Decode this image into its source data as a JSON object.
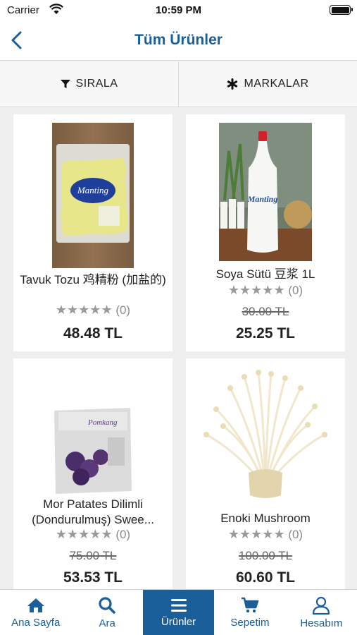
{
  "status_bar": {
    "carrier": "Carrier",
    "time": "10:59 PM"
  },
  "nav": {
    "title": "Tüm Ürünler",
    "back_icon": "chevron-left-icon"
  },
  "filters": [
    {
      "label": "SIRALA",
      "icon": "filter-icon"
    },
    {
      "label": "MARKALAR",
      "icon": "asterisk-icon"
    }
  ],
  "products": [
    {
      "name": "Tavuk Tozu  鸡精粉 (加盐的)",
      "stars": "★★★★★",
      "reviews": "(0)",
      "old_price": "",
      "price": "48.48 TL",
      "image": "chicken-powder-bag"
    },
    {
      "name": "Soya Sütü 豆浆 1L",
      "stars": "★★★★★",
      "reviews": "(0)",
      "old_price": "30.00 TL",
      "price": "25.25 TL",
      "image": "soy-milk-bottle"
    },
    {
      "name": "Mor Patates Dilimli (Dondurulmuş) Swee...",
      "stars": "★★★★★",
      "reviews": "(0)",
      "old_price": "75.00 TL",
      "price": "53.53 TL",
      "image": "purple-potato-bag"
    },
    {
      "name": "Enoki Mushroom",
      "stars": "★★★★★",
      "reviews": "(0)",
      "old_price": "100.00 TL",
      "price": "60.60 TL",
      "image": "enoki-mushroom"
    }
  ],
  "tabs": [
    {
      "label": "Ana Sayfa",
      "icon": "home-icon",
      "active": false
    },
    {
      "label": "Ara",
      "icon": "search-icon",
      "active": false
    },
    {
      "label": "Ürünler",
      "icon": "menu-icon",
      "active": true
    },
    {
      "label": "Sepetim",
      "icon": "cart-icon",
      "active": false
    },
    {
      "label": "Hesabım",
      "icon": "user-icon",
      "active": false
    }
  ],
  "colors": {
    "brand": "#1a5e9a",
    "background": "#efefef",
    "card": "#ffffff"
  }
}
